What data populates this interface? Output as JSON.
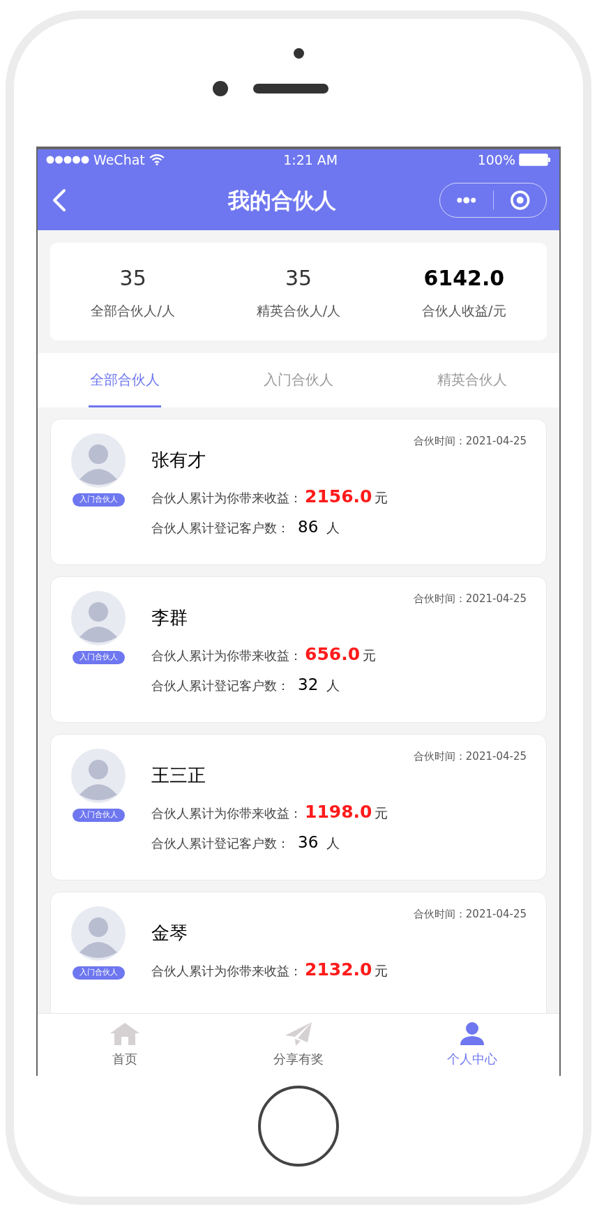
{
  "status_bar": {
    "carrier": "WeChat",
    "time": "1:21 AM",
    "battery": "100%"
  },
  "nav": {
    "title": "我的合伙人"
  },
  "stats": [
    {
      "value": "35",
      "label": "全部合伙人/人"
    },
    {
      "value": "35",
      "label": "精英合伙人/人"
    },
    {
      "value": "6142.0",
      "label": "合伙人收益/元"
    }
  ],
  "tabs": [
    {
      "label": "全部合伙人",
      "selected": true
    },
    {
      "label": "入门合伙人",
      "selected": false
    },
    {
      "label": "精英合伙人",
      "selected": false
    }
  ],
  "partners": [
    {
      "name": "张有才",
      "badge": "入门合伙人",
      "time_label": "合伙时间：",
      "time": "2021-04-25",
      "income_label": "合伙人累计为你带来收益：",
      "income": "2156.0",
      "income_unit": "元",
      "customers_label": "合伙人累计登记客户数：",
      "customers": "86",
      "customers_unit": "人"
    },
    {
      "name": "李群",
      "badge": "入门合伙人",
      "time_label": "合伙时间：",
      "time": "2021-04-25",
      "income_label": "合伙人累计为你带来收益：",
      "income": "656.0",
      "income_unit": "元",
      "customers_label": "合伙人累计登记客户数：",
      "customers": "32",
      "customers_unit": "人"
    },
    {
      "name": "王三正",
      "badge": "入门合伙人",
      "time_label": "合伙时间：",
      "time": "2021-04-25",
      "income_label": "合伙人累计为你带来收益：",
      "income": "1198.0",
      "income_unit": "元",
      "customers_label": "合伙人累计登记客户数：",
      "customers": "36",
      "customers_unit": "人"
    },
    {
      "name": "金琴",
      "badge": "入门合伙人",
      "time_label": "合伙时间：",
      "time": "2021-04-25",
      "income_label": "合伙人累计为你带来收益：",
      "income": "2132.0",
      "income_unit": "元"
    }
  ],
  "tab_bar": [
    {
      "label": "首页",
      "kind": "home",
      "selected": false
    },
    {
      "label": "分享有奖",
      "kind": "share",
      "selected": false
    },
    {
      "label": "个人中心",
      "kind": "profile",
      "selected": true
    }
  ]
}
